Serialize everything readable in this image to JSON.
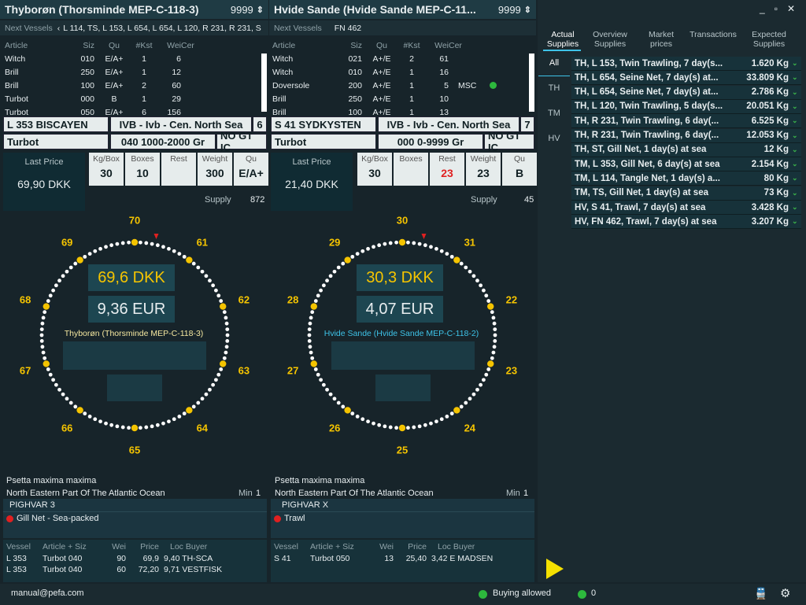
{
  "left": {
    "title": "Thyborøn (Thorsminde MEP-C-118-3)",
    "count": "9999",
    "next_label": "Next Vessels",
    "next_vessels": "L 114, TS, L 153, L 654, L 654, L 120, R 231, R 231, S",
    "cols": [
      "Article",
      "Siz",
      "Qu",
      "#Kst",
      "Wei",
      "Cer"
    ],
    "rows": [
      [
        "Witch",
        "010",
        "E/A+",
        "1",
        "6",
        ""
      ],
      [
        "Brill",
        "250",
        "E/A+",
        "1",
        "12",
        ""
      ],
      [
        "Brill",
        "100",
        "E/A+",
        "2",
        "60",
        ""
      ],
      [
        "Turbot",
        "000",
        "B",
        "1",
        "29",
        ""
      ],
      [
        "Turbot",
        "050",
        "E/A+",
        "6",
        "156",
        ""
      ]
    ],
    "vessel": "L 353 BISCAYEN",
    "area": "IVB - Ivb - Cen. North Sea",
    "area_n": "6",
    "fish": "Turbot",
    "range": "040 1000-2000 Gr",
    "cert": "NO GT IC",
    "last_price_label": "Last Price",
    "last_price": "69,90 DKK",
    "metrics": [
      {
        "k": "Kg/Box",
        "v": "30"
      },
      {
        "k": "Boxes",
        "v": "10"
      },
      {
        "k": "Rest",
        "v": ""
      },
      {
        "k": "Weight",
        "v": "300"
      },
      {
        "k": "Qu",
        "v": "E/A+"
      }
    ],
    "supply_label": "Supply",
    "supply": "872",
    "clock": [
      "70",
      "61",
      "62",
      "63",
      "64",
      "65",
      "66",
      "67",
      "68",
      "69"
    ],
    "price_dkk": "69,6 DKK",
    "price_eur": "9,36 EUR",
    "auction_name": "Thyborøn (Thorsminde MEP-C-118-3)",
    "species": "Psetta maxima maxima",
    "region": "North Eastern Part Of The Atlantic Ocean",
    "min_label": "Min",
    "min": "1",
    "local": "PIGHVAR  3",
    "method": "Gill Net - Sea-packed",
    "tx_cols": [
      "Vessel",
      "Article + Siz",
      "Wei",
      "Price",
      "Loc Buyer"
    ],
    "tx": [
      [
        "L 353",
        "Turbot 040",
        "90",
        "69,9",
        "9,40 TH-SCA"
      ],
      [
        "L 353",
        "Turbot 040",
        "60",
        "72,20",
        "9,71 VESTFISK"
      ]
    ]
  },
  "right": {
    "title": "Hvide Sande (Hvide Sande MEP-C-11...",
    "count": "9999",
    "next_label": "Next Vessels",
    "next_vessels": "FN 462",
    "cols": [
      "Article",
      "Siz",
      "Qu",
      "#Kst",
      "Wei",
      "Cer"
    ],
    "rows": [
      [
        "Witch",
        "021",
        "A+/E",
        "2",
        "61",
        ""
      ],
      [
        "Witch",
        "010",
        "A+/E",
        "1",
        "16",
        ""
      ],
      [
        "Doversole",
        "200",
        "A+/E",
        "1",
        "5",
        "MSC"
      ],
      [
        "Brill",
        "250",
        "A+/E",
        "1",
        "10",
        ""
      ],
      [
        "Brill",
        "100",
        "A+/E",
        "1",
        "13",
        ""
      ]
    ],
    "vessel": "S 41 SYDKYSTEN",
    "area": "IVB - Ivb - Cen. North Sea",
    "area_n": "7",
    "fish": "Turbot",
    "range": "000 0-9999 Gr",
    "cert": "NO GT IC",
    "last_price_label": "Last Price",
    "last_price": "21,40 DKK",
    "metrics": [
      {
        "k": "Kg/Box",
        "v": "30"
      },
      {
        "k": "Boxes",
        "v": ""
      },
      {
        "k": "Rest",
        "v": "23"
      },
      {
        "k": "Weight",
        "v": "23"
      },
      {
        "k": "Qu",
        "v": "B"
      }
    ],
    "supply_label": "Supply",
    "supply": "45",
    "clock": [
      "30",
      "31",
      "22",
      "23",
      "24",
      "25",
      "26",
      "27",
      "28",
      "29"
    ],
    "price_dkk": "30,3 DKK",
    "price_eur": "4,07 EUR",
    "auction_name": "Hvide Sande (Hvide Sande MEP-C-118-2)",
    "species": "Psetta maxima maxima",
    "region": "North Eastern Part Of The Atlantic Ocean",
    "min_label": "Min",
    "min": "1",
    "local": "PIGHVAR  X",
    "method": "Trawl",
    "tx_cols": [
      "Vessel",
      "Article + Siz",
      "Wei",
      "Price",
      "Loc Buyer"
    ],
    "tx": [
      [
        "S 41",
        "Turbot 050",
        "13",
        "25,40",
        "3,42 E MADSEN"
      ]
    ]
  },
  "tabs": [
    "Actual Supplies",
    "Overview Supplies",
    "Market prices",
    "Transactions",
    "Expected Supplies"
  ],
  "side": [
    "All",
    "TH",
    "TM",
    "HV"
  ],
  "supplies": [
    [
      "TH, L 153, Twin Trawling, 7 day(s...",
      "1.620 Kg"
    ],
    [
      "TH, L 654, Seine Net, 7 day(s) at...",
      "33.809 Kg"
    ],
    [
      "TH, L 654, Seine Net, 7 day(s) at...",
      "2.786 Kg"
    ],
    [
      "TH, L 120, Twin Trawling, 5 day(s...",
      "20.051 Kg"
    ],
    [
      "TH, R 231, Twin Trawling, 6 day(...",
      "6.525 Kg"
    ],
    [
      "TH, R 231, Twin Trawling, 6 day(...",
      "12.053 Kg"
    ],
    [
      "TH, ST, Gill Net, 1 day(s) at sea",
      "12 Kg"
    ],
    [
      "TM, L 353, Gill Net, 6 day(s) at sea",
      "2.154 Kg"
    ],
    [
      "TM, L 114, Tangle Net, 1 day(s) a...",
      "80 Kg"
    ],
    [
      "TM, TS, Gill Net, 1 day(s) at sea",
      "73 Kg"
    ],
    [
      "HV, S 41, Trawl, 7 day(s) at sea",
      "3.428 Kg"
    ],
    [
      "HV, FN 462, Trawl, 7 day(s) at sea",
      "3.207 Kg"
    ]
  ],
  "footer": {
    "user": "manual@pefa.com",
    "buying": "Buying allowed",
    "count": "0"
  },
  "colors": {
    "accent": "#f5c400",
    "ok": "#2db83d",
    "alert": "#e02020"
  }
}
